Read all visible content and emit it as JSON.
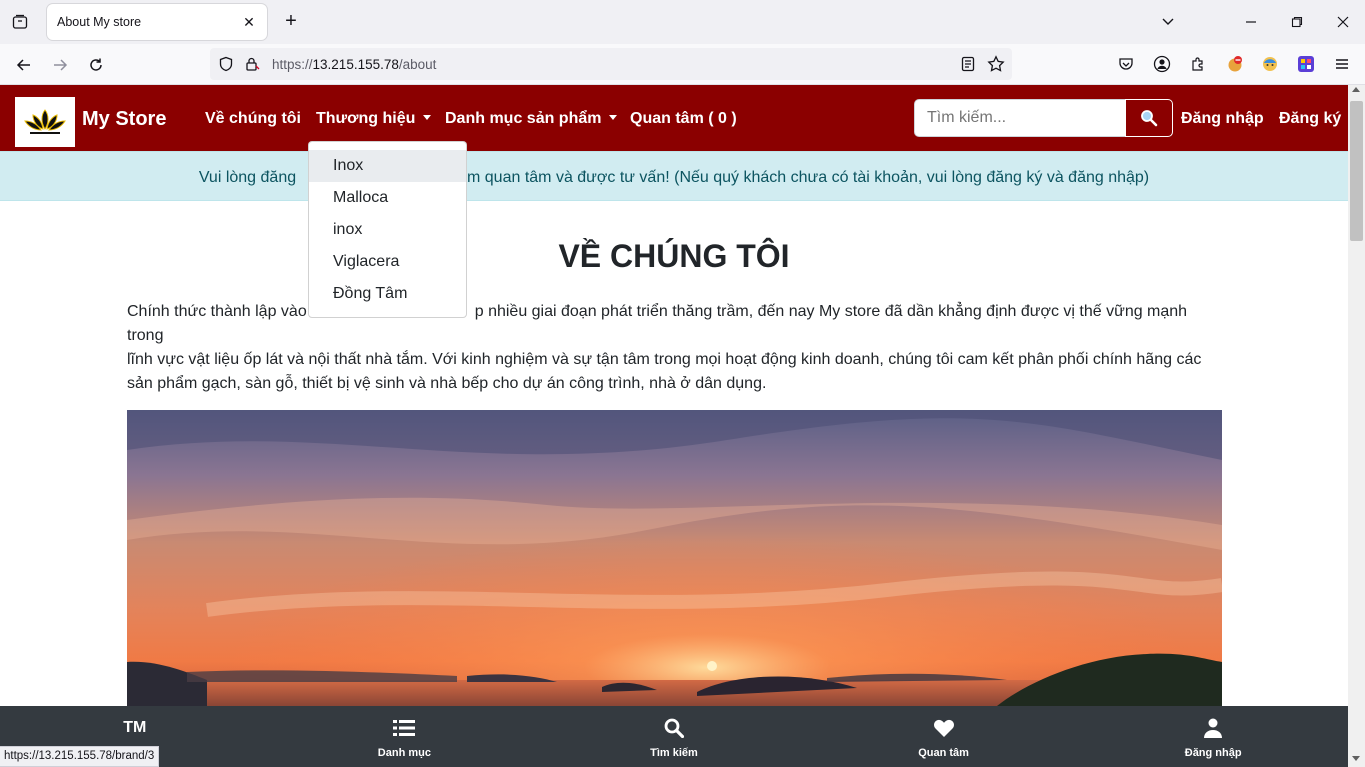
{
  "browser": {
    "tab_title": "About My store",
    "url_prefix": "https://",
    "url_host": "13.215.155.78",
    "url_path": "/about",
    "status_url": "https://13.215.155.78/brand/3"
  },
  "site": {
    "brand": "My Store",
    "nav": {
      "about": "Về chúng tôi",
      "brands": "Thương hiệu",
      "categories": "Danh mục sản phẩm",
      "favorites": "Quan tâm ( 0 )"
    },
    "search_placeholder": "Tìm kiếm...",
    "login": "Đăng nhập",
    "register": "Đăng ký",
    "header_color": "#8b0000"
  },
  "alert": {
    "text_left": "Vui lòng đăng",
    "text_right": "ẩm quan tâm và được tư vấn! (Nếu quý khách chưa có tài khoản, vui lòng đăng ký và đăng nhập)"
  },
  "brand_dropdown": {
    "items": [
      "Inox",
      "Malloca",
      "inox",
      "Viglacera",
      "Đồng Tâm"
    ]
  },
  "about": {
    "title": "VỀ CHÚNG TÔI",
    "line1_left": "Chính thức thành lập vào",
    "line1_right": "p nhiều giai đoạn phát triển thăng trầm, đến nay My store đã dần khẳng định được vị thế vững mạnh trong",
    "line2": "lĩnh vực vật liệu ốp lát và nội thất nhà tắm. Với kinh nghiệm và sự tận tâm trong mọi hoạt động kinh doanh, chúng tôi cam kết phân phối chính hãng các",
    "line3": "sản phẩm gạch, sàn gỗ, thiết bị vệ sinh và nhà bếp cho dự án công trình, nhà ở dân dụng."
  },
  "bottom_nav": {
    "home_icon_text": "TM",
    "home_label": "",
    "categories": "Danh mục",
    "search": "Tìm kiếm",
    "favorites": "Quan tâm",
    "login": "Đăng nhập"
  }
}
